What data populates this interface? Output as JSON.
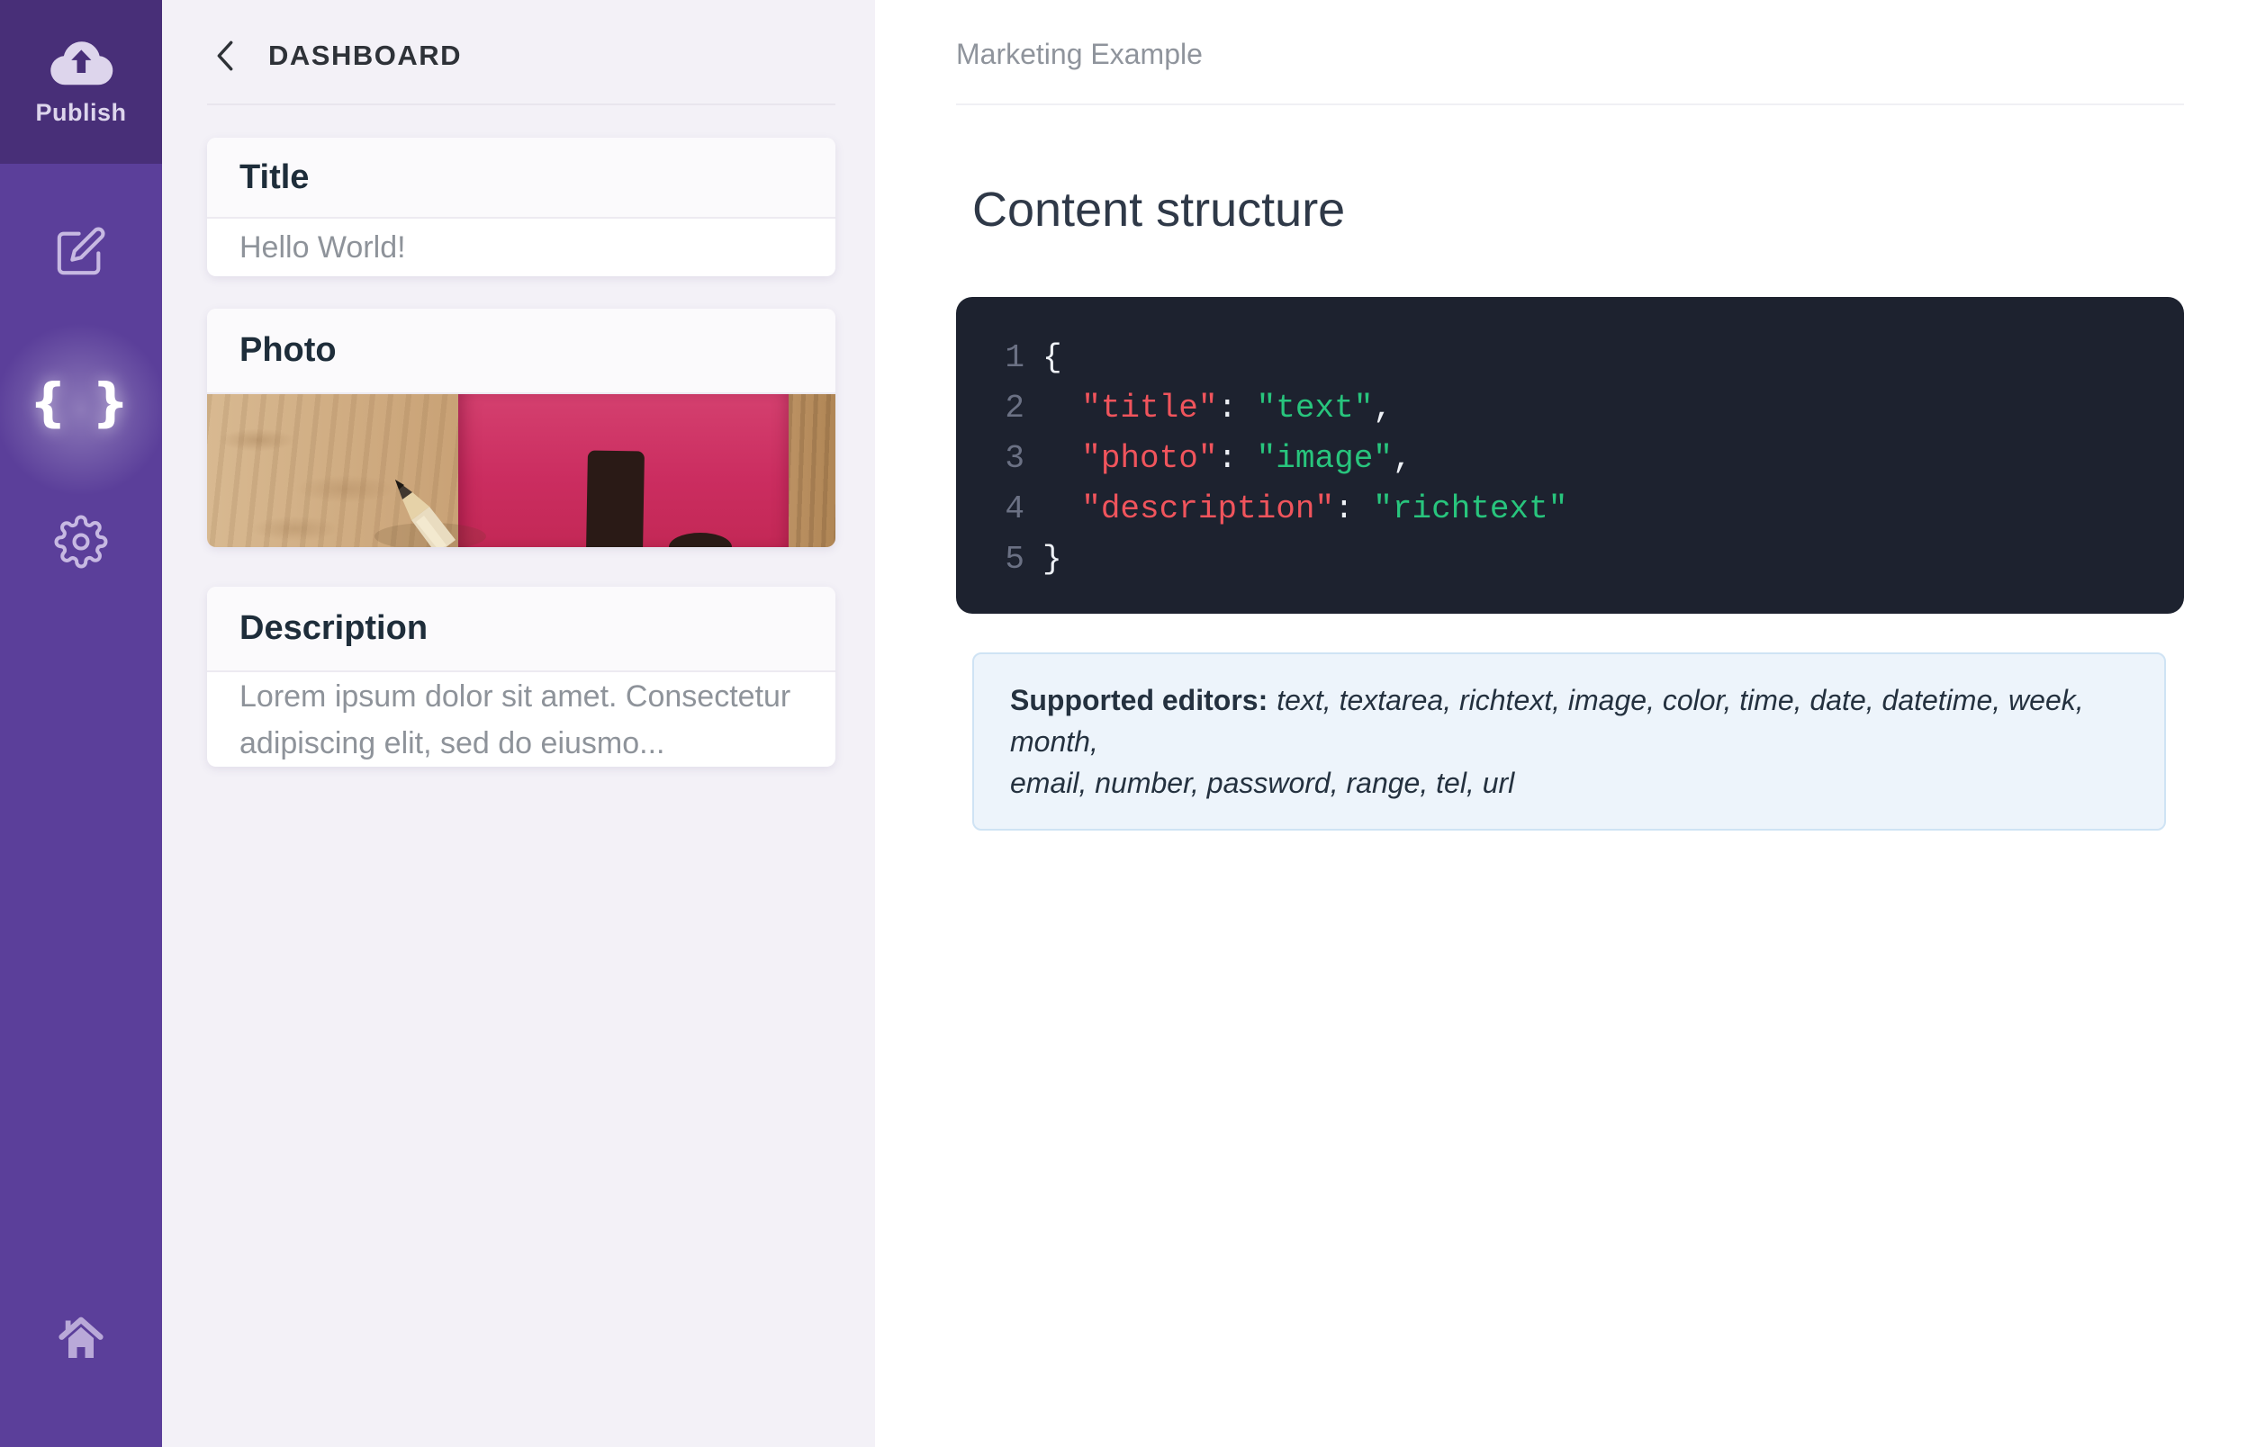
{
  "colors": {
    "sidebar": "#5b3f9a",
    "publish": "#482f78",
    "code-bg": "#1d222f",
    "code-key": "#f0545c",
    "code-value": "#28c57d",
    "code-plain": "#eef1f6",
    "code-num": "#6b7184",
    "info-bg": "#edf4fb",
    "info-border": "#cfe3f4",
    "pink": "#cb2d60"
  },
  "sidebar": {
    "publish_label": "Publish",
    "braces_glyph": "{ }",
    "icons": [
      "cloud-upload",
      "edit",
      "braces",
      "settings",
      "home"
    ]
  },
  "middle_panel": {
    "back_label": "DASHBOARD",
    "cards": [
      {
        "title": "Title",
        "body": "Hello World!"
      },
      {
        "title": "Photo"
      },
      {
        "title": "Description",
        "body_line1": "Lorem ipsum dolor sit amet. Consectetur",
        "body_line2": "adipiscing elit, sed do eiusmo..."
      }
    ]
  },
  "main": {
    "breadcrumb": "Marketing Example",
    "heading": "Content structure",
    "code": {
      "lines": [
        {
          "num": "1",
          "tokens": [
            {
              "t": "{",
              "c": "plain"
            }
          ]
        },
        {
          "num": "2",
          "tokens": [
            {
              "t": "  ",
              "c": "plain"
            },
            {
              "t": "\"title\"",
              "c": "key"
            },
            {
              "t": ": ",
              "c": "plain"
            },
            {
              "t": "\"text\"",
              "c": "value"
            },
            {
              "t": ",",
              "c": "plain"
            }
          ]
        },
        {
          "num": "3",
          "tokens": [
            {
              "t": "  ",
              "c": "plain"
            },
            {
              "t": "\"photo\"",
              "c": "key"
            },
            {
              "t": ": ",
              "c": "plain"
            },
            {
              "t": "\"image\"",
              "c": "value"
            },
            {
              "t": ",",
              "c": "plain"
            }
          ]
        },
        {
          "num": "4",
          "tokens": [
            {
              "t": "  ",
              "c": "plain"
            },
            {
              "t": "\"description\"",
              "c": "key"
            },
            {
              "t": ": ",
              "c": "plain"
            },
            {
              "t": "\"richtext\"",
              "c": "value"
            }
          ]
        },
        {
          "num": "5",
          "tokens": [
            {
              "t": "}",
              "c": "plain"
            }
          ]
        }
      ]
    },
    "info": {
      "label": "Supported editors:",
      "line1": "text, textarea, richtext, image, color, time, date, datetime, week, month,",
      "line2": "email, number, password, range, tel, url"
    }
  }
}
